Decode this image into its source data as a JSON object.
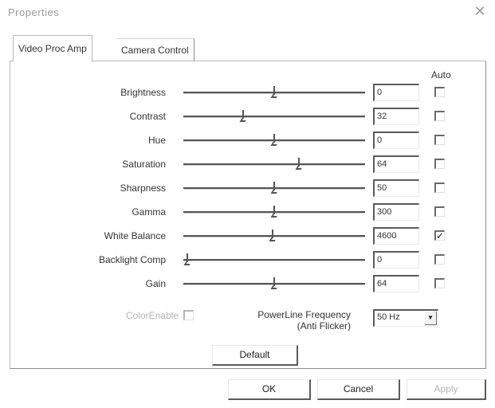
{
  "window": {
    "title": "Properties"
  },
  "tabs": [
    {
      "label": "Video Proc Amp",
      "active": true
    },
    {
      "label": "Camera Control",
      "active": false
    }
  ],
  "auto_label": "Auto",
  "controls": [
    {
      "label": "Brightness",
      "value": "0",
      "level": 0.5,
      "auto": false
    },
    {
      "label": "Contrast",
      "value": "32",
      "level": 0.32,
      "auto": false
    },
    {
      "label": "Hue",
      "value": "0",
      "level": 0.5,
      "auto": false
    },
    {
      "label": "Saturation",
      "value": "64",
      "level": 0.64,
      "auto": false
    },
    {
      "label": "Sharpness",
      "value": "50",
      "level": 0.5,
      "auto": false
    },
    {
      "label": "Gamma",
      "value": "300",
      "level": 0.5,
      "auto": false
    },
    {
      "label": "White Balance",
      "value": "4600",
      "level": 0.49,
      "auto": true
    },
    {
      "label": "Backlight Comp",
      "value": "0",
      "level": 0.0,
      "auto": false
    },
    {
      "label": "Gain",
      "value": "64",
      "level": 0.5,
      "auto": false
    }
  ],
  "color_enable": {
    "label": "ColorEnable",
    "checked": false,
    "disabled": true
  },
  "powerline": {
    "label_line1": "PowerLine Frequency",
    "label_line2": "(Anti Flicker)",
    "selected": "50 Hz"
  },
  "buttons": {
    "default": "Default",
    "ok": "OK",
    "cancel": "Cancel",
    "apply": "Apply"
  },
  "icons": {
    "close": "close-icon",
    "dropdown": "chevron-down-icon"
  }
}
